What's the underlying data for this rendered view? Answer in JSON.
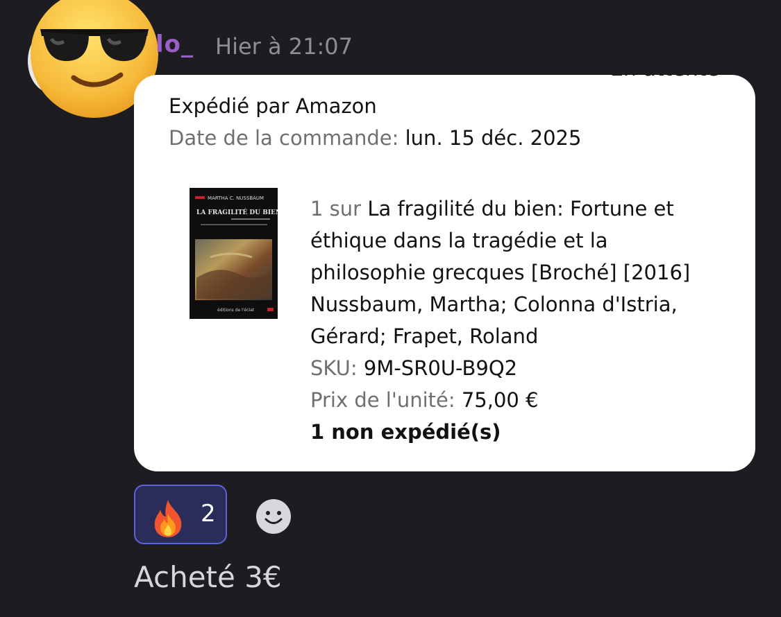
{
  "message": {
    "username": "lo_",
    "timestamp": "Hier à 21:07",
    "avatar_icon": "sunglasses-emoji-icon",
    "text": "Acheté 3€"
  },
  "order_card": {
    "status_partial": "En attente",
    "shipped_by": "Expédié par Amazon",
    "order_date_label": "Date de la commande:",
    "order_date_value": "lun. 15 déc. 2025",
    "item": {
      "cover_icon": "book-cover-image",
      "cover_author": "MARTHA C. NUSSBAUM",
      "cover_title": "LA FRAGILITÉ DU BIEN",
      "cover_publisher": "éditions de l'éclat",
      "quantity_label": "1 sur",
      "title_lines": [
        "La fragilité du bien: Fortune et",
        "éthique dans la tragédie et la",
        "philosophie grecques [Broché] [2016]"
      ],
      "author_lines": [
        "Nussbaum, Martha; Colonna d'Istria,",
        "Gérard; Frapet, Roland"
      ],
      "sku_label": "SKU:",
      "sku_value": "9M-SR0U-B9Q2",
      "price_label": "Prix de l'unité:",
      "price_value": "75,00 €",
      "not_shipped": "1 non expédié(s)"
    }
  },
  "reactions": [
    {
      "icon": "fire-emoji-icon",
      "count": "2"
    }
  ],
  "add_reaction_icon": "smiley-icon",
  "colors": {
    "background": "#1c1c21",
    "username": "#9a5fc7",
    "reaction_border": "#5865d9",
    "not_shipped": "#c47a2c"
  }
}
